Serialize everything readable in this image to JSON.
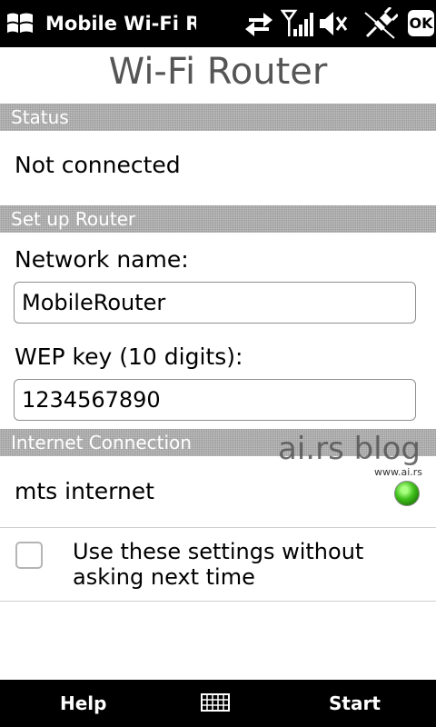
{
  "status_bar": {
    "app_title": "Mobile Wi-Fi Ro",
    "ok_label": "OK",
    "icons": [
      "windows-start-icon",
      "data-sync-icon",
      "signal-strength-icon",
      "volume-mute-icon",
      "usb-plug-icon"
    ]
  },
  "header": {
    "title": "Wi-Fi Router"
  },
  "status_section": {
    "heading": "Status",
    "value": "Not connected"
  },
  "setup_section": {
    "heading": "Set up Router",
    "network_name_label": "Network name:",
    "network_name_value": "MobileRouter",
    "wep_key_label": "WEP key (10 digits):",
    "wep_key_value": "1234567890"
  },
  "internet_section": {
    "heading": "Internet Connection",
    "connection_name": "mts internet",
    "status_color": "#3fbf1b"
  },
  "watermark": {
    "text": "ai.rs blog",
    "url": "www.ai.rs"
  },
  "options": {
    "remember_label": "Use these settings without asking next time",
    "remember_checked": false
  },
  "softkeys": {
    "left": "Help",
    "right": "Start",
    "center_icon": "keyboard-icon"
  }
}
